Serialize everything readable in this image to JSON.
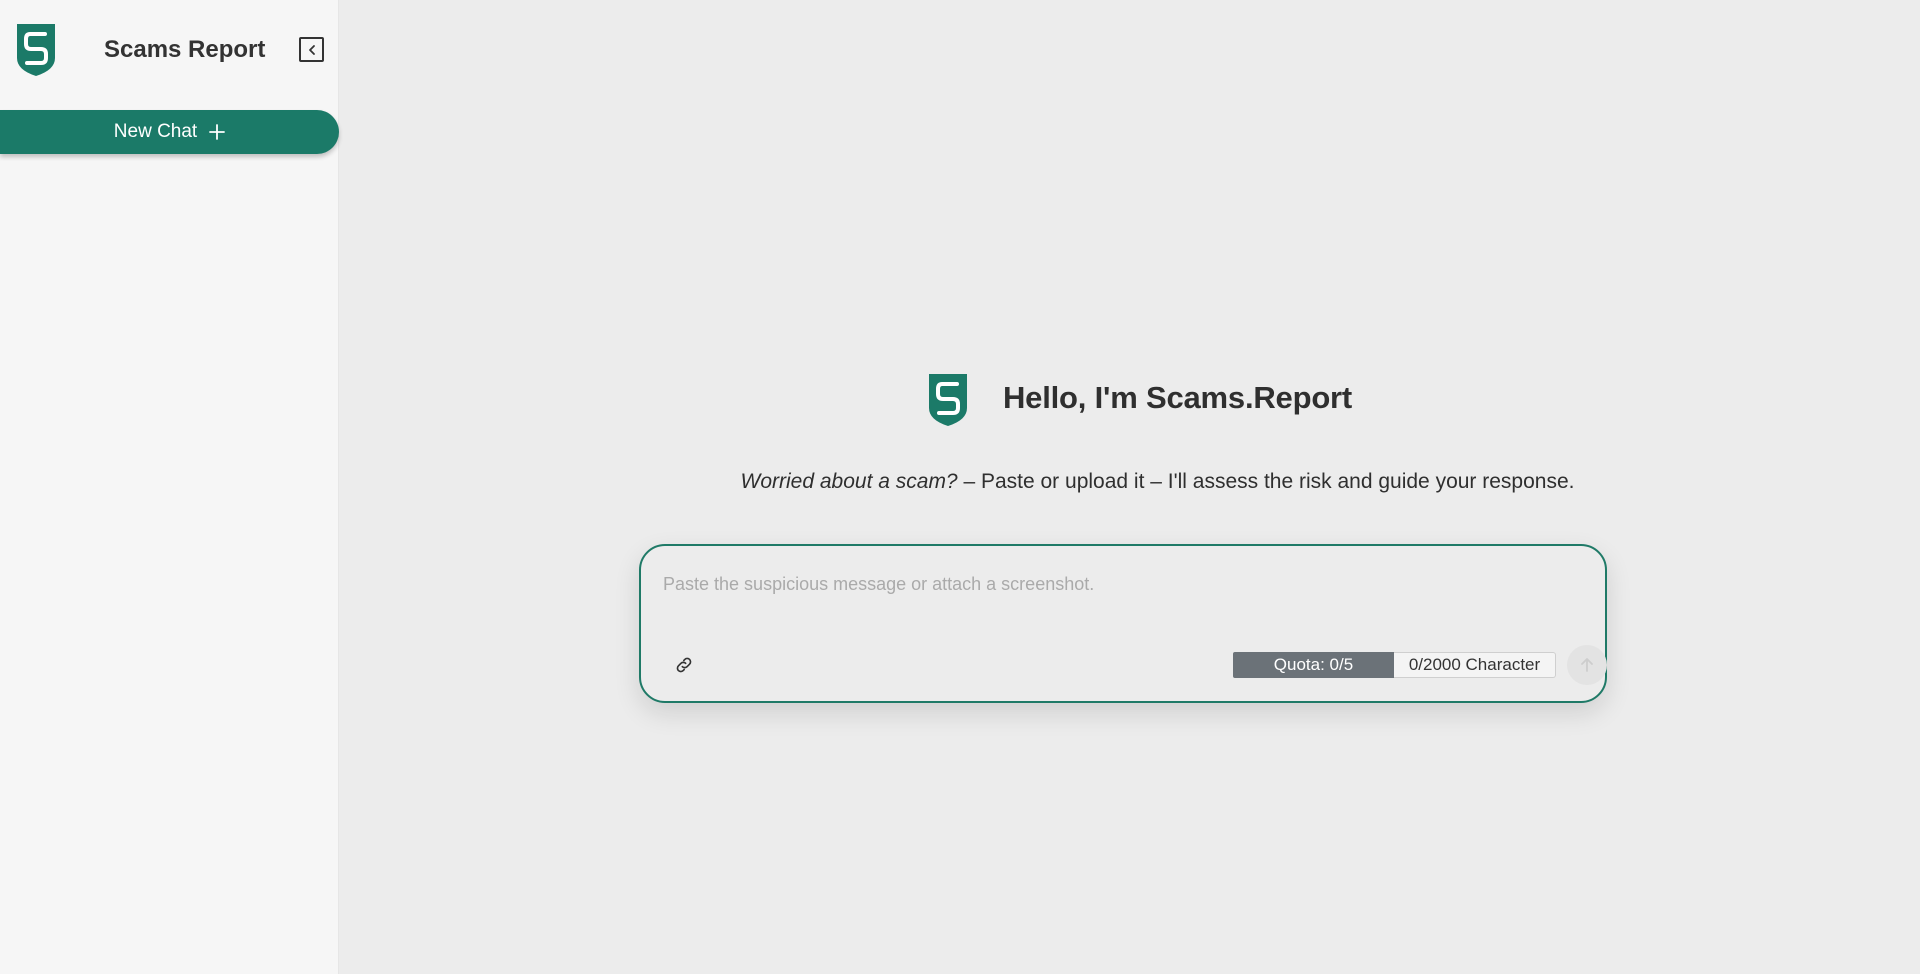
{
  "sidebar": {
    "brand_title": "Scams Report",
    "new_chat_label": "New Chat"
  },
  "main": {
    "hero_title": "Hello, I'm Scams.Report",
    "subtitle_emphasis": "Worried about a scam?",
    "subtitle_rest": " – Paste or upload it – I'll assess the risk and guide your response.",
    "composer": {
      "placeholder": "Paste the suspicious message or attach a screenshot.",
      "value": "",
      "quota": "Quota: 0/5",
      "char_count": "0/2000 Character"
    }
  },
  "icons": {
    "logo": "shield-s-logo",
    "collapse": "collapse-sidebar-icon",
    "new_chat": "plus-icon",
    "attach": "link-icon",
    "send": "arrow-up-icon"
  },
  "colors": {
    "brand": "#1b7a68",
    "sidebar_bg": "#f6f6f6",
    "main_bg": "#ececec",
    "quota_bg": "#6b7278"
  }
}
